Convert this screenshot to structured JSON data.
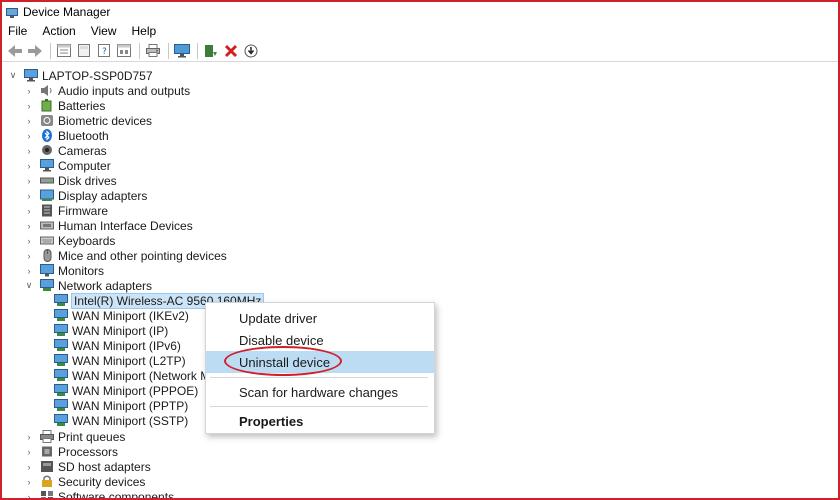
{
  "window": {
    "title": "Device Manager"
  },
  "menu": [
    "File",
    "Action",
    "View",
    "Help"
  ],
  "toolbar_icons": [
    "back-arrow-icon",
    "forward-arrow-icon",
    "properties-sheet-icon",
    "blank-page-icon",
    "help-page-icon",
    "device-view-icon",
    "print-icon",
    "monitor-icon",
    "update-driver-icon",
    "uninstall-x-icon",
    "download-circle-icon"
  ],
  "tree": {
    "root": "LAPTOP-SSP0D757",
    "categories": [
      {
        "label": "Audio inputs and outputs",
        "icon": "speaker-icon"
      },
      {
        "label": "Batteries",
        "icon": "battery-icon"
      },
      {
        "label": "Biometric devices",
        "icon": "fingerprint-icon"
      },
      {
        "label": "Bluetooth",
        "icon": "bluetooth-icon"
      },
      {
        "label": "Cameras",
        "icon": "camera-icon"
      },
      {
        "label": "Computer",
        "icon": "computer-icon"
      },
      {
        "label": "Disk drives",
        "icon": "disk-drive-icon"
      },
      {
        "label": "Display adapters",
        "icon": "display-adapter-icon"
      },
      {
        "label": "Firmware",
        "icon": "firmware-icon"
      },
      {
        "label": "Human Interface Devices",
        "icon": "hid-icon"
      },
      {
        "label": "Keyboards",
        "icon": "keyboard-icon"
      },
      {
        "label": "Mice and other pointing devices",
        "icon": "mouse-icon"
      },
      {
        "label": "Monitors",
        "icon": "monitor-icon"
      },
      {
        "label": "Network adapters",
        "icon": "network-adapter-icon",
        "expanded": true
      }
    ],
    "network_children": [
      "Intel(R) Wireless-AC 9560 160MHz",
      "WAN Miniport (IKEv2)",
      "WAN Miniport (IP)",
      "WAN Miniport (IPv6)",
      "WAN Miniport (L2TP)",
      "WAN Miniport (Network Monit",
      "WAN Miniport (PPPOE)",
      "WAN Miniport (PPTP)",
      "WAN Miniport (SSTP)"
    ],
    "categories_after": [
      {
        "label": "Print queues",
        "icon": "printer-icon"
      },
      {
        "label": "Processors",
        "icon": "processor-icon"
      },
      {
        "label": "SD host adapters",
        "icon": "sd-card-icon"
      },
      {
        "label": "Security devices",
        "icon": "security-icon"
      },
      {
        "label": "Software components",
        "icon": "software-icon"
      }
    ]
  },
  "context_menu": {
    "items": [
      "Update driver",
      "Disable device",
      "Uninstall device",
      "Scan for hardware changes",
      "Properties"
    ],
    "highlighted": "Uninstall device"
  },
  "colors": {
    "selection": "#cce4f7",
    "menu_highlight": "#bcdcf4",
    "annotation_red": "#d0202a"
  }
}
